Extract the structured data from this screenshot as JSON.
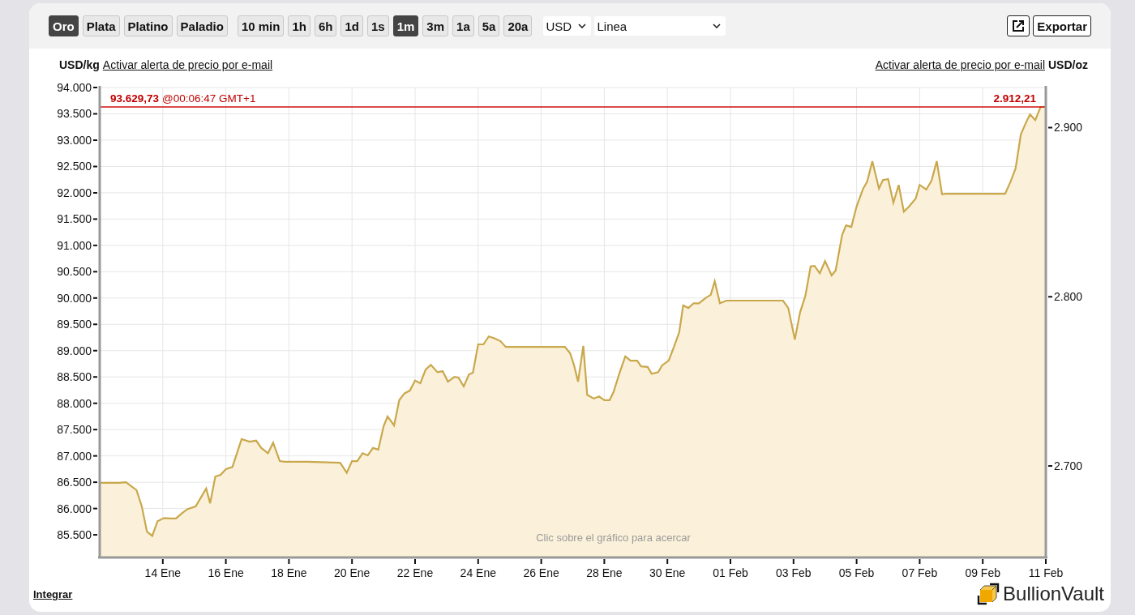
{
  "toolbar": {
    "metals": [
      {
        "label": "Oro",
        "selected": true
      },
      {
        "label": "Plata",
        "selected": false
      },
      {
        "label": "Platino",
        "selected": false
      },
      {
        "label": "Paladio",
        "selected": false
      }
    ],
    "ranges": [
      {
        "label": "10 min",
        "selected": false
      },
      {
        "label": "1h",
        "selected": false
      },
      {
        "label": "6h",
        "selected": false
      },
      {
        "label": "1d",
        "selected": false
      },
      {
        "label": "1s",
        "selected": false
      },
      {
        "label": "1m",
        "selected": true
      },
      {
        "label": "3m",
        "selected": false
      },
      {
        "label": "1a",
        "selected": false
      },
      {
        "label": "5a",
        "selected": false
      },
      {
        "label": "20a",
        "selected": false
      }
    ],
    "currency": "USD",
    "chart_type": "Linea",
    "export_label": "Exportar"
  },
  "chart": {
    "left_alert_link": "Activar alerta de precio por e-mail",
    "right_alert_link": "Activar alerta de precio por e-mail",
    "hint": "Clic sobre el gráfico para acercar",
    "chart_data": {
      "type": "area",
      "ylabel": "USD/kg",
      "xlim": [
        "--01-12",
        "--02-11"
      ],
      "ylim": [
        85070,
        94000
      ],
      "xticks": [
        {
          "value": "--01-14",
          "label": "14 Ene"
        },
        {
          "value": "--01-16",
          "label": "16 Ene"
        },
        {
          "value": "--01-18",
          "label": "18 Ene"
        },
        {
          "value": "--01-20",
          "label": "20 Ene"
        },
        {
          "value": "--01-22",
          "label": "22 Ene"
        },
        {
          "value": "--01-24",
          "label": "24 Ene"
        },
        {
          "value": "--01-26",
          "label": "26 Ene"
        },
        {
          "value": "--01-28",
          "label": "28 Ene"
        },
        {
          "value": "--01-30",
          "label": "30 Ene"
        },
        {
          "value": "--02-01",
          "label": "01 Feb"
        },
        {
          "value": "--02-03",
          "label": "03 Feb"
        },
        {
          "value": "--02-05",
          "label": "05 Feb"
        },
        {
          "value": "--02-07",
          "label": "07 Feb"
        },
        {
          "value": "--02-09",
          "label": "09 Feb"
        },
        {
          "value": "--02-11",
          "label": "11 Feb"
        }
      ],
      "yticks": [
        {
          "value": 85500,
          "label": "85.500"
        },
        {
          "value": 86000,
          "label": "86.000"
        },
        {
          "value": 86500,
          "label": "86.500"
        },
        {
          "value": 87000,
          "label": "87.000"
        },
        {
          "value": 87500,
          "label": "87.500"
        },
        {
          "value": 88000,
          "label": "88.000"
        },
        {
          "value": 88500,
          "label": "88.500"
        },
        {
          "value": 89000,
          "label": "89.000"
        },
        {
          "value": 89500,
          "label": "89.500"
        },
        {
          "value": 90000,
          "label": "90.000"
        },
        {
          "value": 90500,
          "label": "90.500"
        },
        {
          "value": 91000,
          "label": "91.000"
        },
        {
          "value": 91500,
          "label": "91.500"
        },
        {
          "value": 92000,
          "label": "92.000"
        },
        {
          "value": 92500,
          "label": "92.500"
        },
        {
          "value": 93000,
          "label": "93.000"
        },
        {
          "value": 93500,
          "label": "93.500"
        },
        {
          "value": 94000,
          "label": "94.000"
        }
      ],
      "y2label": "USD/oz",
      "y2lim": [
        2645.9,
        2923.7
      ],
      "y2ticks": [
        {
          "value": 2700,
          "label": "2.700"
        },
        {
          "value": 2800,
          "label": "2.800"
        },
        {
          "value": 2900,
          "label": "2.900"
        }
      ],
      "x": [
        "--01-12T00:00",
        "--01-12T15:00",
        "--01-12T20:00",
        "--01-13T04:00",
        "--01-13T08:00",
        "--01-13T12:00",
        "--01-13T16:00",
        "--01-13T20:00",
        "--01-14T01:00",
        "--01-14T06:00",
        "--01-14T10:00",
        "--01-14T15:00",
        "--01-14T19:00",
        "--01-15T01:00",
        "--01-15T09:00",
        "--01-15T12:00",
        "--01-15T16:00",
        "--01-15T20:00",
        "--01-16T00:00",
        "--01-16T05:00",
        "--01-16T08:00",
        "--01-16T12:00",
        "--01-16T18:00",
        "--01-16T23:00",
        "--01-17T03:00",
        "--01-17T08:00",
        "--01-17T12:00",
        "--01-17T17:00",
        "--01-17T21:00",
        "--01-18T14:00",
        "--01-19T15:00",
        "--01-19T20:00",
        "--01-20T00:00",
        "--01-20T04:00",
        "--01-20T08:00",
        "--01-20T12:00",
        "--01-20T16:00",
        "--01-20T20:00",
        "--01-21T00:00",
        "--01-21T03:00",
        "--01-21T08:00",
        "--01-21T12:00",
        "--01-21T16:00",
        "--01-21T20:00",
        "--01-22T00:00",
        "--01-22T04:00",
        "--01-22T08:00",
        "--01-22T12:00",
        "--01-22T17:00",
        "--01-22T21:00",
        "--01-23T01:00",
        "--01-23T06:00",
        "--01-23T09:00",
        "--01-23T13:00",
        "--01-23T17:00",
        "--01-23T20:00",
        "--01-24T00:00",
        "--01-24T04:00",
        "--01-24T08:00",
        "--01-24T12:00",
        "--01-24T17:00",
        "--01-24T21:00",
        "--01-26T18:00",
        "--01-26T22:00",
        "--01-27T01:00",
        "--01-27T04:00",
        "--01-27T08:00",
        "--01-27T11:00",
        "--01-27T16:00",
        "--01-27T20:00",
        "--01-28T00:00",
        "--01-28T04:00",
        "--01-28T07:00",
        "--01-28T12:00",
        "--01-28T16:00",
        "--01-28T20:00",
        "--01-29T01:00",
        "--01-29T04:00",
        "--01-29T09:00",
        "--01-29T12:00",
        "--01-29T17:00",
        "--01-29T20:00",
        "--01-30T01:00",
        "--01-30T05:00",
        "--01-30T09:00",
        "--01-30T12:00",
        "--01-30T16:00",
        "--01-30T20:00",
        "--01-31T00:00",
        "--01-31T05:00",
        "--01-31T09:00",
        "--01-31T12:00",
        "--01-31T16:00",
        "--01-31T21:00",
        "--02-02T16:00",
        "--02-02T20:00",
        "--02-03T01:00",
        "--02-03T05:00",
        "--02-03T09:00",
        "--02-03T13:00",
        "--02-03T16:00",
        "--02-03T20:00",
        "--02-04T00:00",
        "--02-04T05:00",
        "--02-04T08:00",
        "--02-04T13:00",
        "--02-04T16:00",
        "--02-04T20:00",
        "--02-05T00:00",
        "--02-05T05:00",
        "--02-05T08:00",
        "--02-05T12:00",
        "--02-05T17:00",
        "--02-05T20:00",
        "--02-06T00:00",
        "--02-06T04:00",
        "--02-06T08:00",
        "--02-06T12:00",
        "--02-06T16:00",
        "--02-06T21:00",
        "--02-07T00:00",
        "--02-07T05:00",
        "--02-07T09:00",
        "--02-07T13:00",
        "--02-07T17:00",
        "--02-07T20:00",
        "--02-09T17:00",
        "--02-09T21:00",
        "--02-10T01:00",
        "--02-10T05:00",
        "--02-10T09:00",
        "--02-10T12:00",
        "--02-10T16:00",
        "--02-10T20:00",
        "--02-10T23:30"
      ],
      "series": [
        {
          "color": "#c9a84c",
          "values": [
            86490,
            86490,
            86500,
            86350,
            86040,
            85560,
            85480,
            85760,
            85820,
            85810,
            85810,
            85920,
            85990,
            86040,
            86380,
            86100,
            86610,
            86640,
            86750,
            86790,
            87020,
            87320,
            87270,
            87290,
            87150,
            87050,
            87250,
            86900,
            86890,
            86890,
            86870,
            86680,
            86900,
            86900,
            87050,
            87010,
            87150,
            87120,
            87560,
            87750,
            87580,
            88060,
            88190,
            88240,
            88430,
            88380,
            88640,
            88730,
            88590,
            88610,
            88410,
            88500,
            88490,
            88320,
            88550,
            88580,
            89120,
            89120,
            89270,
            89240,
            89180,
            89070,
            89070,
            88950,
            88720,
            88410,
            89090,
            88160,
            88090,
            88130,
            88060,
            88060,
            88210,
            88610,
            88890,
            88810,
            88810,
            88700,
            88690,
            88560,
            88590,
            88720,
            88810,
            89070,
            89350,
            89860,
            89810,
            89900,
            89900,
            90000,
            90060,
            90320,
            89900,
            89950,
            89950,
            89810,
            89210,
            89730,
            90040,
            90600,
            90610,
            90470,
            90700,
            90430,
            90520,
            91200,
            91380,
            91350,
            91740,
            92080,
            92210,
            92600,
            92080,
            92240,
            92260,
            91810,
            92150,
            91640,
            91740,
            91890,
            92150,
            92060,
            92230,
            92600,
            91970,
            91980,
            91980,
            92200,
            92460,
            93110,
            93340,
            93490,
            93380,
            93630,
            93630
          ]
        }
      ],
      "grid": true,
      "ref_lines": [
        {
          "axis": "y",
          "value": 93629.73,
          "label": "93.629,73",
          "color": "#cc1111"
        }
      ],
      "annotations": [
        "@00:06:47 GMT+1",
        "2.912,21"
      ]
    }
  },
  "footer": {
    "embed_link": "Integrar",
    "logo_text": "BullionVault"
  }
}
